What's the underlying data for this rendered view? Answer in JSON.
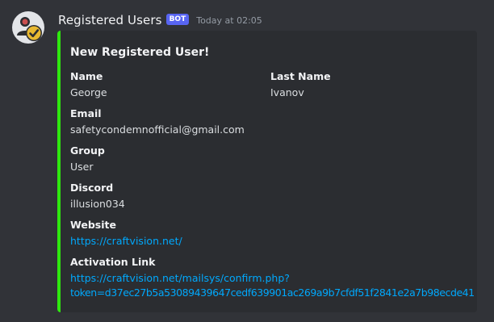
{
  "header": {
    "username": "Registered Users",
    "bot_tag": "BOT",
    "timestamp": "Today at 02:05"
  },
  "avatar": {
    "icon": "registered-user-checkmark-icon",
    "background": "#e3e5e8",
    "badge_color": "#e8b830"
  },
  "embed": {
    "accent_color": "#2ee80f",
    "title": "New Registered User!",
    "fields": {
      "name": {
        "label": "Name",
        "value": "George"
      },
      "last_name": {
        "label": "Last Name",
        "value": "Ivanov"
      },
      "email": {
        "label": "Email",
        "value": "safetycondemnofficial@gmail.com"
      },
      "group": {
        "label": "Group",
        "value": "User"
      },
      "discord": {
        "label": "Discord",
        "value": "illusion034"
      },
      "website": {
        "label": "Website",
        "value": "https://craftvision.net/"
      },
      "activation": {
        "label": "Activation Link",
        "value_line1": "https://craftvision.net/mailsys/confirm.php?",
        "value_line2": "token=d37ec27b5a53089439647cedf639901ac269a9b7cfdf51f2841e2a7b98ecde41"
      }
    }
  }
}
